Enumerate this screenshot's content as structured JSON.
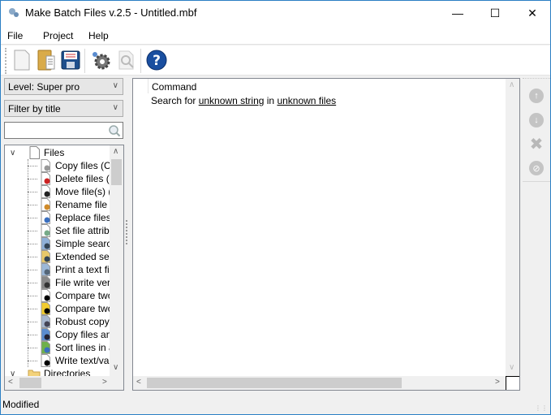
{
  "window": {
    "title": "Make Batch Files v.2.5 - Untitled.mbf",
    "minimize_glyph": "—",
    "maximize_glyph": "☐",
    "close_glyph": "✕"
  },
  "menu": [
    "File",
    "Project",
    "Help"
  ],
  "toolbar": {
    "buttons": [
      {
        "name": "new-file-icon",
        "glyph": ""
      },
      {
        "name": "open-file-icon",
        "glyph": ""
      },
      {
        "name": "save-file-icon",
        "glyph": ""
      },
      {
        "name": "settings-gear-icon",
        "glyph": "⚙"
      },
      {
        "name": "preview-search-icon",
        "glyph": "🔍"
      },
      {
        "name": "help-icon",
        "glyph": "?"
      }
    ]
  },
  "left_panel": {
    "level_select": "Level: Super pro",
    "filter_select": "Filter by title",
    "search_value": "",
    "tree": {
      "root": "Files",
      "items": [
        "Copy files (CO",
        "Delete files (D",
        "Move file(s) (",
        "Rename file (",
        "Replace files ",
        "Set file attribu",
        "Simple search",
        "Extended sea",
        "Print a text fil",
        "File write veri",
        "Compare two",
        "Compare two",
        "Robust copy",
        "Copy files and",
        "Sort lines in a",
        "Write text/va"
      ],
      "next_root": "Directories"
    }
  },
  "main": {
    "column_header": "Command",
    "command": {
      "prefix": "Search for ",
      "param1": "unknown string",
      "middle": " in ",
      "param2": "unknown files"
    }
  },
  "side_actions": [
    "move-up",
    "move-down",
    "delete",
    "disable"
  ],
  "status": "Modified",
  "colors": {
    "window_border": "#2b7fc4",
    "help_blue": "#1a4fa0",
    "disabled_gray": "#c4c4c4"
  }
}
